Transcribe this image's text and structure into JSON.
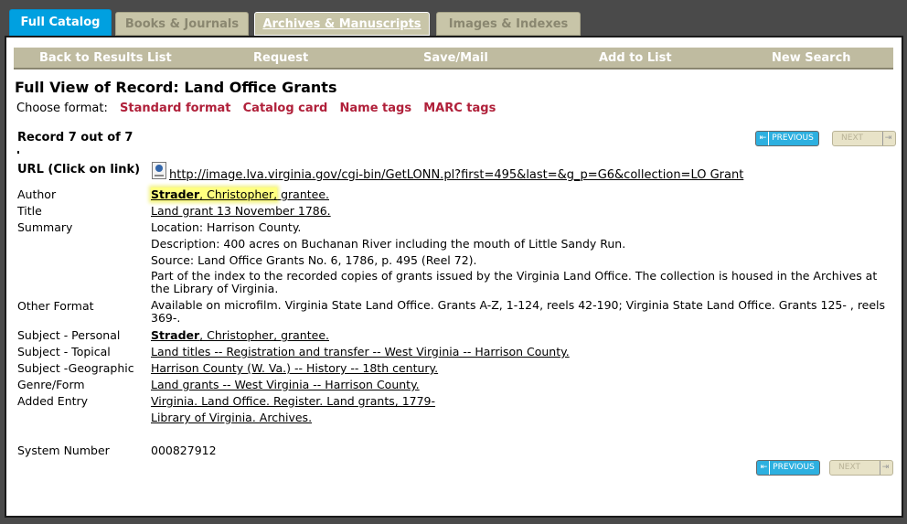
{
  "tabs": {
    "full_catalog": "Full Catalog",
    "books_journals": "Books & Journals",
    "archives": "Archives & Manuscripts",
    "images": "Images & Indexes"
  },
  "nav": {
    "back": "Back to Results List",
    "request": "Request",
    "save": "Save/Mail",
    "add": "Add to List",
    "new_search": "New Search"
  },
  "page": {
    "title": "Full View of Record: Land Office Grants",
    "choose_format": "Choose format:",
    "formats": [
      "Standard format",
      "Catalog card",
      "Name tags",
      "MARC tags"
    ],
    "record_count": "Record 7 out of 7",
    "previous": "PREVIOUS",
    "next": "NEXT"
  },
  "record": {
    "url_label": "URL (Click on link)",
    "url": "http://image.lva.virginia.gov/cgi-bin/GetLONN.pl?first=495&last=&g_p=G6&collection=LO Grant",
    "author_label": "Author",
    "author_bold": "Strader",
    "author_rest": ", Christopher,",
    "author_tail": " grantee.",
    "title_label": "Title",
    "title": "Land grant 13 November 1786.",
    "summary_label": "Summary",
    "summary": [
      "Location: Harrison County.",
      "Description: 400 acres on Buchanan River including the mouth of Little Sandy Run.",
      "Source: Land Office Grants No. 6, 1786, p. 495 (Reel 72).",
      "Part of the index to the recorded copies of grants issued by the Virginia Land Office. The collection is housed in the Archives at the Library of Virginia."
    ],
    "other_format_label": "Other Format",
    "other_format": "Available on microfilm. Virginia State Land Office. Grants A-Z, 1-124, reels 42-190; Virginia State Land Office. Grants 125- , reels 369-.",
    "subject_personal_label": "Subject - Personal",
    "subject_personal_bold": "Strader",
    "subject_personal_rest": ", Christopher, grantee.",
    "subject_topical_label": "Subject - Topical",
    "subject_topical": "Land titles -- Registration and transfer -- West Virginia -- Harrison County.",
    "subject_geo_label": "Subject -Geographic",
    "subject_geo": "Harrison County (W. Va.) -- History -- 18th century.",
    "genre_label": "Genre/Form",
    "genre": "Land grants -- West Virginia -- Harrison County.",
    "added_entry_label": "Added Entry",
    "added_entry": [
      "Virginia. Land Office. Register. Land grants, 1779-",
      "Library of Virginia. Archives."
    ],
    "system_number_label": "System Number",
    "system_number": "000827912"
  }
}
